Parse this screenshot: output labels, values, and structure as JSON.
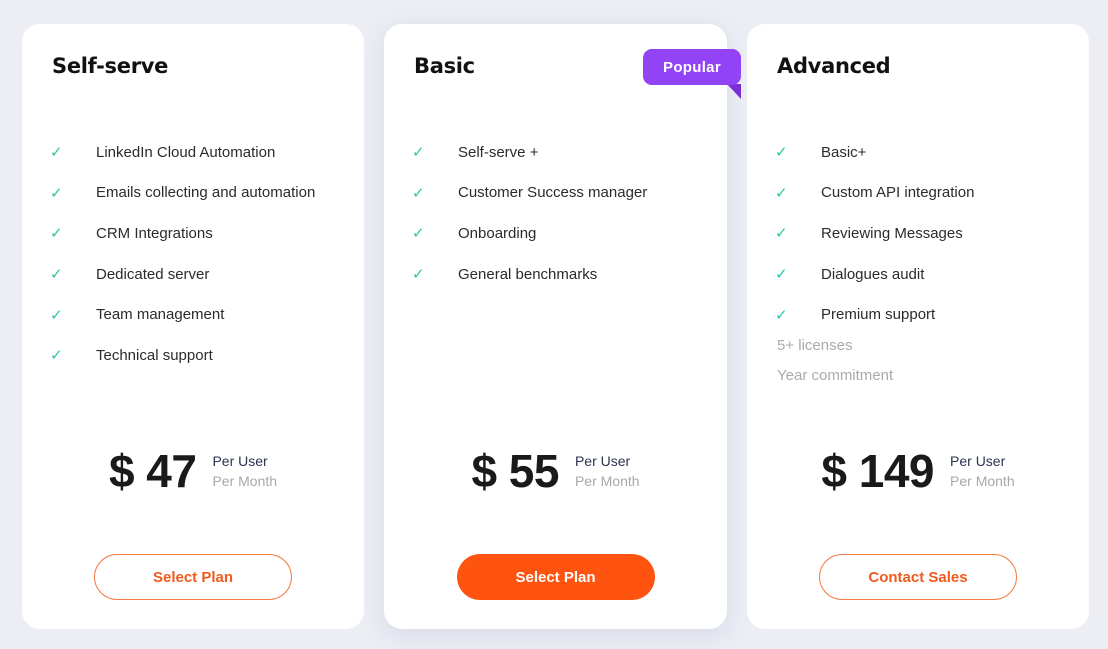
{
  "plans": [
    {
      "name": "Self-serve",
      "features": [
        "LinkedIn Cloud Automation",
        "Emails collecting and automation",
        "CRM Integrations",
        "Dedicated server",
        "Team management",
        "Technical support"
      ],
      "extras": [],
      "price": "$ 47",
      "per_user": "Per User",
      "per_month": "Per Month",
      "button": "Select Plan"
    },
    {
      "name": "Basic",
      "badge": "Popular",
      "features": [
        "Self-serve +",
        "Customer Success manager",
        "Onboarding",
        "General benchmarks"
      ],
      "extras": [],
      "price": "$ 55",
      "per_user": "Per User",
      "per_month": "Per Month",
      "button": "Select Plan"
    },
    {
      "name": "Advanced",
      "features": [
        "Basic+",
        "Custom API integration",
        "Reviewing Messages",
        "Dialogues audit",
        "Premium support"
      ],
      "extras": [
        "5+ licenses",
        "Year commitment"
      ],
      "price": "$ 149",
      "per_user": "Per User",
      "per_month": "Per Month",
      "button": "Contact Sales"
    }
  ],
  "icons": {
    "feature": "check-icon"
  },
  "colors": {
    "accent": "#ff5410",
    "badge": "#9143f5",
    "check": "#2ec4a7"
  }
}
